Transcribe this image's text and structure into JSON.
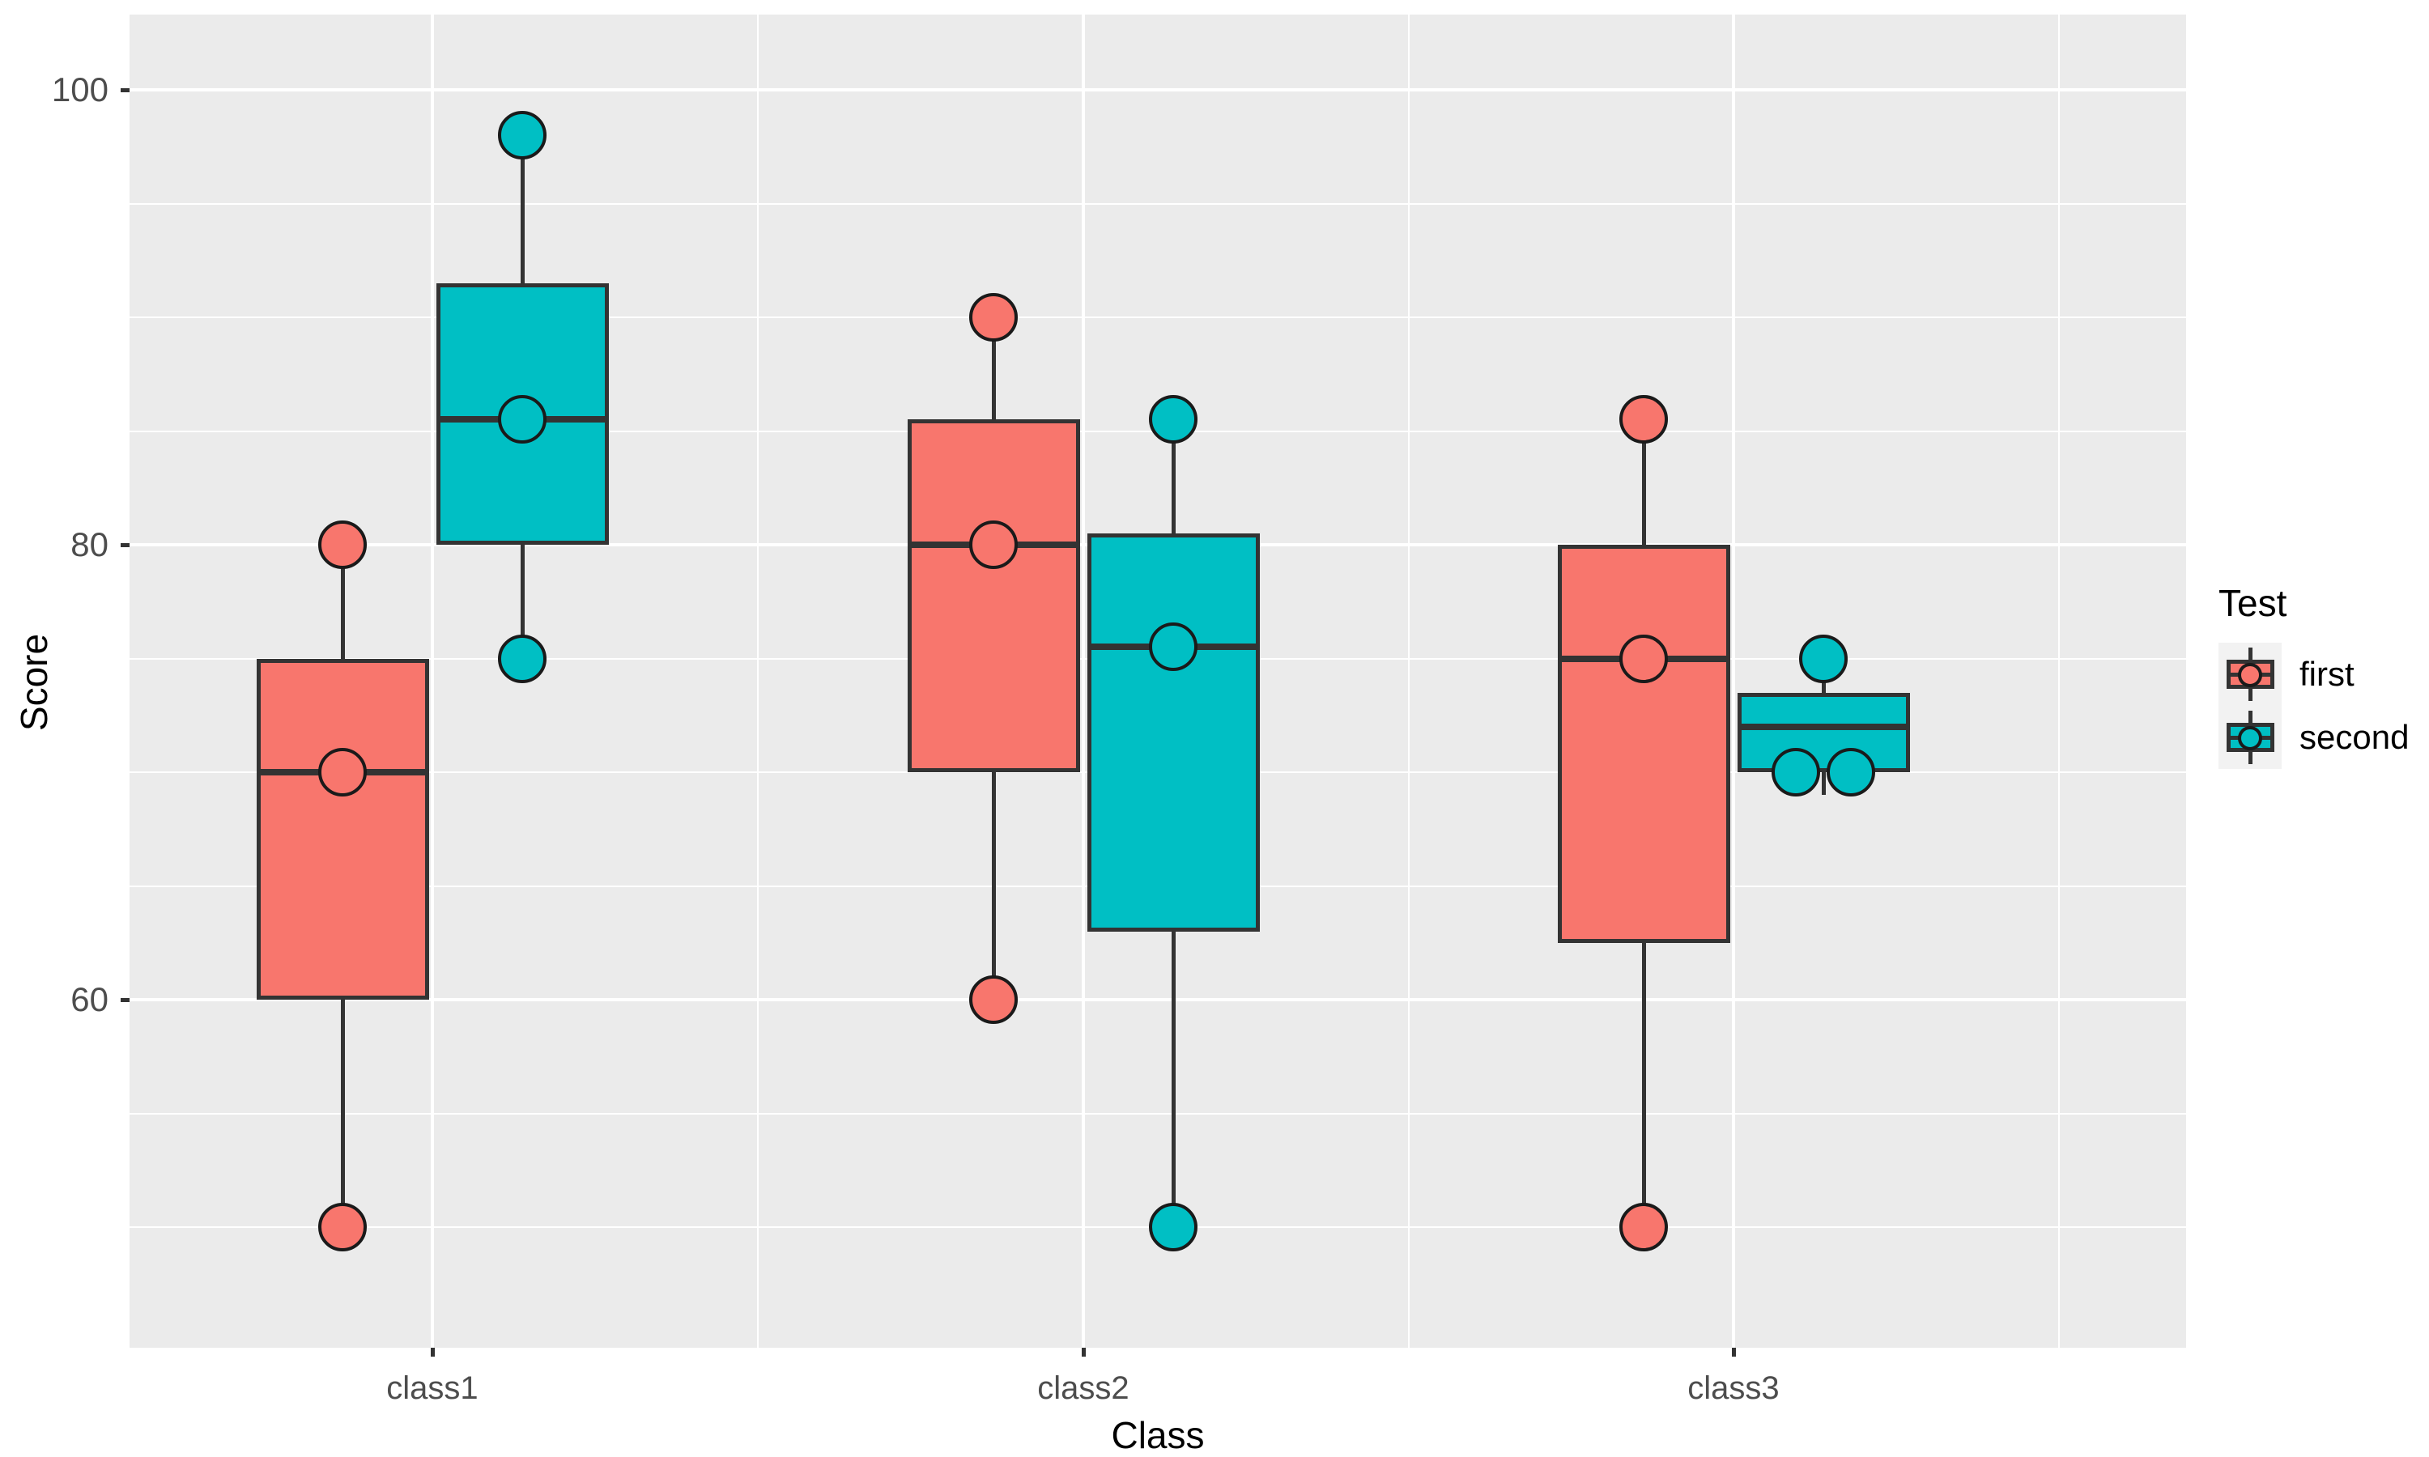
{
  "chart_data": {
    "type": "boxplot",
    "title": "",
    "xlabel": "Class",
    "ylabel": "Score",
    "categories": [
      "class1",
      "class2",
      "class3"
    ],
    "legend_title": "Test",
    "legend_position": "right",
    "grid": true,
    "ylim": [
      45,
      103
    ],
    "yticks": [
      60,
      80,
      100
    ],
    "ytick_labels": [
      "60",
      "80",
      "100"
    ],
    "colors": {
      "first": "#F8766D",
      "second": "#00BFC4",
      "panel_background": "#EBEBEB",
      "gridline": "#FFFFFF",
      "outline": "#333333",
      "text": "#4D4D4D"
    },
    "series": [
      {
        "name": "first",
        "color": "#F8766D",
        "boxes": [
          {
            "category": "class1",
            "lower_whisker": 50,
            "q1": 60,
            "median": 70,
            "q3": 75,
            "upper_whisker": 80,
            "points": [
              {
                "value": 80
              },
              {
                "value": 70
              },
              {
                "value": 50
              }
            ]
          },
          {
            "category": "class2",
            "lower_whisker": 60,
            "q1": 70,
            "median": 80,
            "q3": 85.5,
            "upper_whisker": 90,
            "points": [
              {
                "value": 90
              },
              {
                "value": 80
              },
              {
                "value": 60
              }
            ]
          },
          {
            "category": "class3",
            "lower_whisker": 50,
            "q1": 62.5,
            "median": 75,
            "q3": 80,
            "upper_whisker": 85.5,
            "points": [
              {
                "value": 85.5
              },
              {
                "value": 75
              },
              {
                "value": 50
              }
            ]
          }
        ]
      },
      {
        "name": "second",
        "color": "#00BFC4",
        "boxes": [
          {
            "category": "class1",
            "lower_whisker": 75,
            "q1": 80,
            "median": 85.5,
            "q3": 91.5,
            "upper_whisker": 98,
            "points": [
              {
                "value": 98
              },
              {
                "value": 85.5
              },
              {
                "value": 75
              }
            ]
          },
          {
            "category": "class2",
            "lower_whisker": 50,
            "q1": 63,
            "median": 75.5,
            "q3": 80.5,
            "upper_whisker": 85.5,
            "points": [
              {
                "value": 85.5
              },
              {
                "value": 75.5
              },
              {
                "value": 50
              }
            ]
          },
          {
            "category": "class3",
            "lower_whisker": 69,
            "q1": 70,
            "median": 72,
            "q3": 73.5,
            "upper_whisker": 75,
            "points": [
              {
                "value": 75,
                "jitter": 0
              },
              {
                "value": 70,
                "jitter": -1
              },
              {
                "value": 70,
                "jitter": 1
              }
            ]
          }
        ]
      }
    ],
    "legend_items": [
      {
        "label": "first",
        "color": "#F8766D"
      },
      {
        "label": "second",
        "color": "#00BFC4"
      }
    ]
  },
  "axis": {
    "y_title": "Score",
    "x_title": "Class",
    "y_ticks": [
      {
        "label": "100",
        "value": 100
      },
      {
        "label": "80",
        "value": 80
      },
      {
        "label": "60",
        "value": 60
      }
    ],
    "x_ticks": [
      {
        "label": "class1"
      },
      {
        "label": "class2"
      },
      {
        "label": "class3"
      }
    ]
  },
  "legend": {
    "title": "Test",
    "items": [
      {
        "label": "first"
      },
      {
        "label": "second"
      }
    ]
  }
}
